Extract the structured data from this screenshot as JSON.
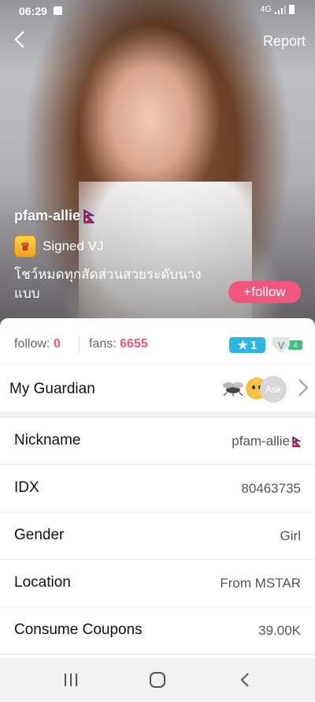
{
  "status_bar": {
    "time": "06:29",
    "network": "4G"
  },
  "header": {
    "report_label": "Report"
  },
  "profile": {
    "name": "pfam-allie",
    "signed_label": "Signed VJ",
    "bio": "โชว์หมดทุกสัดส่วนสวยระดับนางแบบ",
    "follow_button": "+follow"
  },
  "stats": {
    "follow_label": "follow:",
    "follow_count": "0",
    "fans_label": "fans:",
    "fans_count": "6655",
    "level": "1",
    "vip_level": "4"
  },
  "guardian": {
    "label": "My Guardian",
    "ask_label": "Ask"
  },
  "details": [
    {
      "key": "Nickname",
      "value": "pfam-allie"
    },
    {
      "key": "IDX",
      "value": "80463735"
    },
    {
      "key": "Gender",
      "value": "Girl"
    },
    {
      "key": "Location",
      "value": "From MSTAR"
    },
    {
      "key": "Consume Coupons",
      "value": "39.00K"
    }
  ],
  "colors": {
    "accent": "#f0567e",
    "level_badge": "#2bb5e0"
  }
}
